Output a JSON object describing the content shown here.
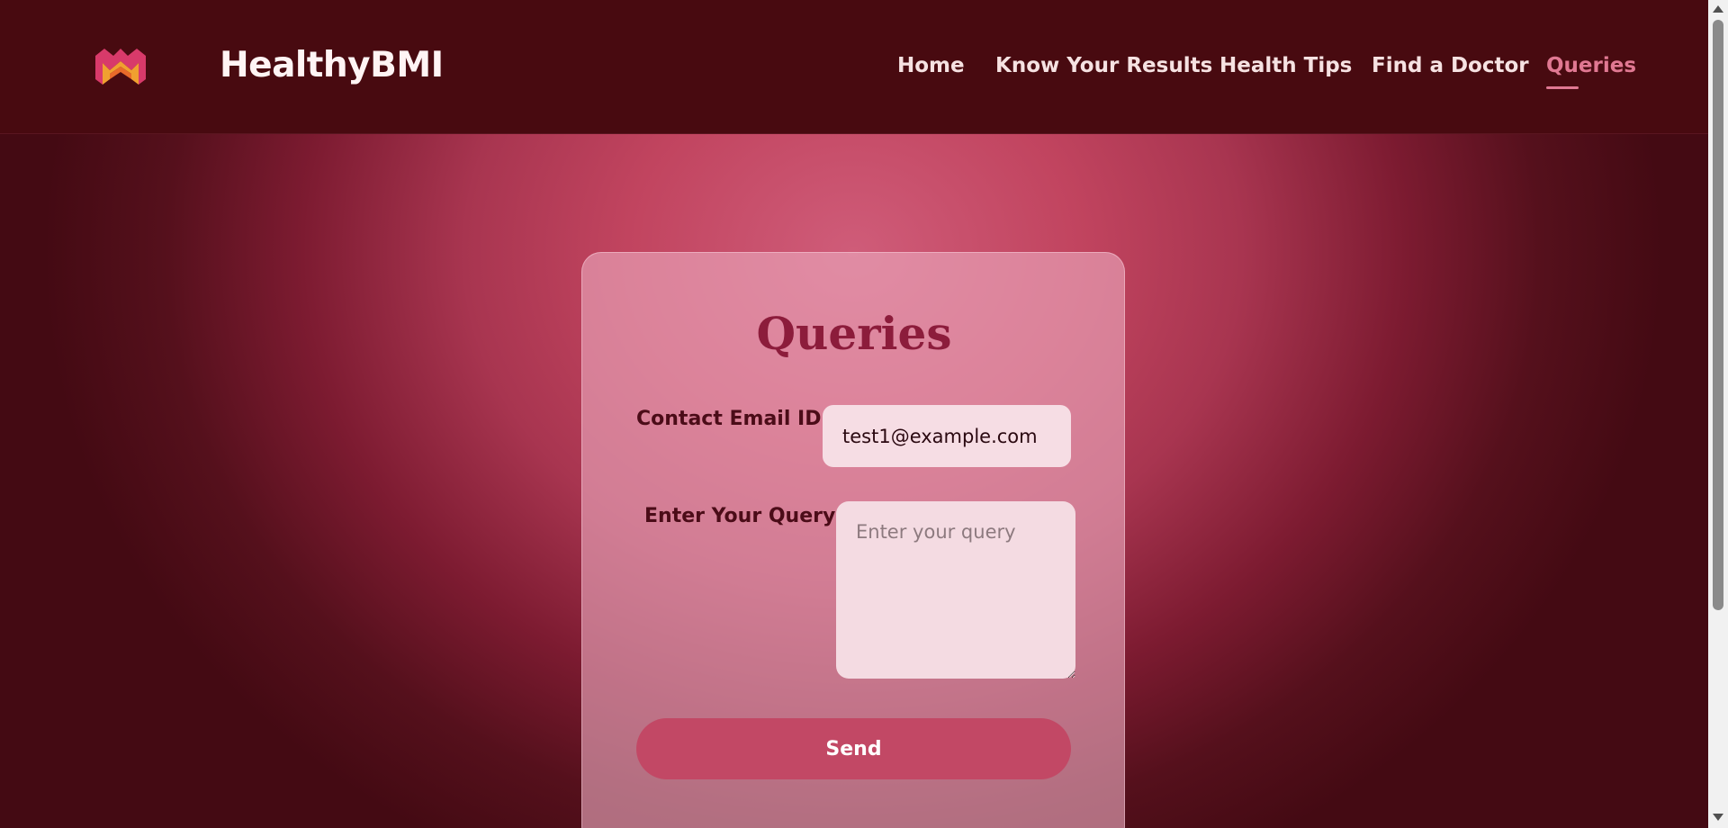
{
  "brand": {
    "name": "HealthyBMI",
    "logo_icon": "mm-logo-icon"
  },
  "nav": {
    "items": [
      {
        "label": "Home",
        "active": false
      },
      {
        "label": "Know Your Results",
        "active": false
      },
      {
        "label": "Health Tips",
        "active": false
      },
      {
        "label": "Find a Doctor",
        "active": false
      },
      {
        "label": "Queries",
        "active": true
      }
    ]
  },
  "form": {
    "title": "Queries",
    "email_label": "Contact Email ID",
    "email_value": "test1@example.com",
    "query_label": "Enter Your Query",
    "query_placeholder": "Enter your query",
    "send_label": "Send"
  },
  "colors": {
    "header_bg": "#480a10",
    "accent": "#e07892",
    "title": "#8c1c3b",
    "button": "#c24865"
  }
}
